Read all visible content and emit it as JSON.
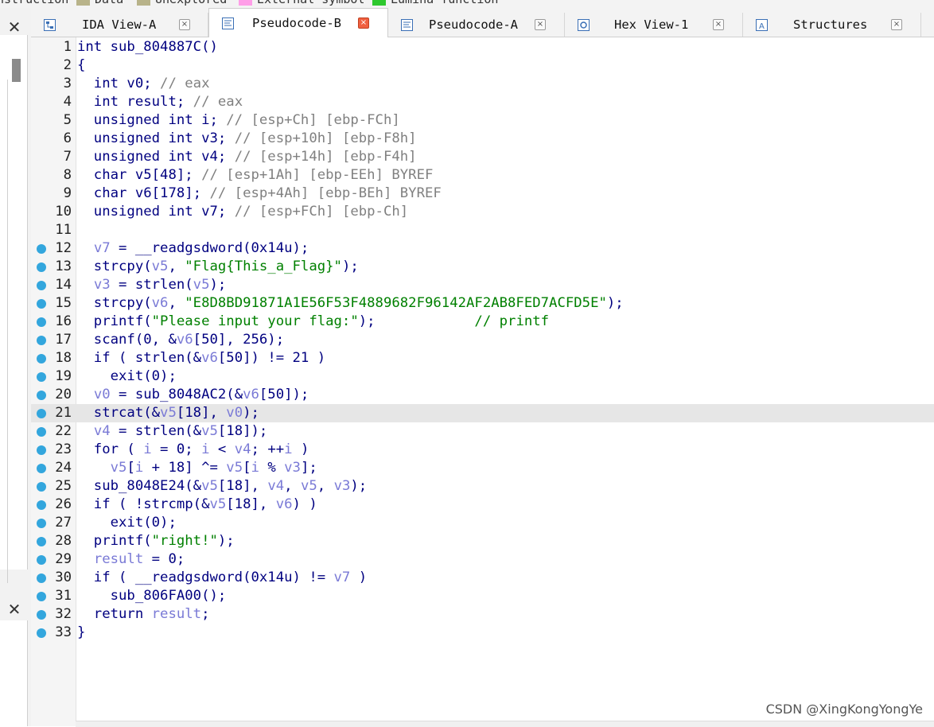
{
  "legend": [
    {
      "label": "nstruction",
      "color": "#ffffff"
    },
    {
      "label": "Data",
      "color": "#b8b38a"
    },
    {
      "label": "Unexplored",
      "color": "#b8b38a"
    },
    {
      "label": "External symbol",
      "color": "#ff9ee8"
    },
    {
      "label": "Lumina function",
      "color": "#2ec82e"
    }
  ],
  "tabs": [
    {
      "label": "IDA View-A",
      "icon": "graph-view-icon",
      "active": false
    },
    {
      "label": "Pseudocode-B",
      "icon": "pseudocode-icon",
      "active": true
    },
    {
      "label": "Pseudocode-A",
      "icon": "pseudocode-icon",
      "active": false
    },
    {
      "label": "Hex View-1",
      "icon": "hex-view-icon",
      "active": false
    },
    {
      "label": "Structures",
      "icon": "structures-icon",
      "active": false
    }
  ],
  "tab_close_glyph": "×",
  "panel_close_glyph": "✕",
  "highlighted_line": "21",
  "lines": [
    {
      "n": "1",
      "dot": false,
      "segs": [
        {
          "t": "int sub_804887C()",
          "c": "k"
        }
      ]
    },
    {
      "n": "2",
      "dot": false,
      "segs": [
        {
          "t": "{",
          "c": "k"
        }
      ]
    },
    {
      "n": "3",
      "dot": false,
      "segs": [
        {
          "t": "  int v0; ",
          "c": "k"
        },
        {
          "t": "// eax",
          "c": "cmt"
        }
      ]
    },
    {
      "n": "4",
      "dot": false,
      "segs": [
        {
          "t": "  int result; ",
          "c": "k"
        },
        {
          "t": "// eax",
          "c": "cmt"
        }
      ]
    },
    {
      "n": "5",
      "dot": false,
      "segs": [
        {
          "t": "  unsigned int i; ",
          "c": "k"
        },
        {
          "t": "// [esp+Ch] [ebp-FCh]",
          "c": "cmt"
        }
      ]
    },
    {
      "n": "6",
      "dot": false,
      "segs": [
        {
          "t": "  unsigned int v3; ",
          "c": "k"
        },
        {
          "t": "// [esp+10h] [ebp-F8h]",
          "c": "cmt"
        }
      ]
    },
    {
      "n": "7",
      "dot": false,
      "segs": [
        {
          "t": "  unsigned int v4; ",
          "c": "k"
        },
        {
          "t": "// [esp+14h] [ebp-F4h]",
          "c": "cmt"
        }
      ]
    },
    {
      "n": "8",
      "dot": false,
      "segs": [
        {
          "t": "  char v5[48]; ",
          "c": "k"
        },
        {
          "t": "// [esp+1Ah] [ebp-EEh] BYREF",
          "c": "cmt"
        }
      ]
    },
    {
      "n": "9",
      "dot": false,
      "segs": [
        {
          "t": "  char v6[178]; ",
          "c": "k"
        },
        {
          "t": "// [esp+4Ah] [ebp-BEh] BYREF",
          "c": "cmt"
        }
      ]
    },
    {
      "n": "10",
      "dot": false,
      "segs": [
        {
          "t": "  unsigned int v7; ",
          "c": "k"
        },
        {
          "t": "// [esp+FCh] [ebp-Ch]",
          "c": "cmt"
        }
      ]
    },
    {
      "n": "11",
      "dot": false,
      "segs": [
        {
          "t": "",
          "c": "k"
        }
      ]
    },
    {
      "n": "12",
      "dot": true,
      "segs": [
        {
          "t": "  ",
          "c": "k"
        },
        {
          "t": "v7",
          "c": "var"
        },
        {
          "t": " = __readgsdword(0x14u);",
          "c": "k"
        }
      ]
    },
    {
      "n": "13",
      "dot": true,
      "segs": [
        {
          "t": "  strcpy(",
          "c": "k"
        },
        {
          "t": "v5",
          "c": "var"
        },
        {
          "t": ", ",
          "c": "k"
        },
        {
          "t": "\"Flag{This_a_Flag}\"",
          "c": "str"
        },
        {
          "t": ");",
          "c": "k"
        }
      ]
    },
    {
      "n": "14",
      "dot": true,
      "segs": [
        {
          "t": "  ",
          "c": "k"
        },
        {
          "t": "v3",
          "c": "var"
        },
        {
          "t": " = strlen(",
          "c": "k"
        },
        {
          "t": "v5",
          "c": "var"
        },
        {
          "t": ");",
          "c": "k"
        }
      ]
    },
    {
      "n": "15",
      "dot": true,
      "segs": [
        {
          "t": "  strcpy(",
          "c": "k"
        },
        {
          "t": "v6",
          "c": "var"
        },
        {
          "t": ", ",
          "c": "k"
        },
        {
          "t": "\"E8D8BD91871A1E56F53F4889682F96142AF2AB8FED7ACFD5E\"",
          "c": "str"
        },
        {
          "t": ");",
          "c": "k"
        }
      ]
    },
    {
      "n": "16",
      "dot": true,
      "segs": [
        {
          "t": "  printf(",
          "c": "k"
        },
        {
          "t": "\"Please input your flag:\"",
          "c": "str"
        },
        {
          "t": ");            ",
          "c": "k"
        },
        {
          "t": "// printf",
          "c": "str"
        }
      ]
    },
    {
      "n": "17",
      "dot": true,
      "segs": [
        {
          "t": "  scanf(0, &",
          "c": "k"
        },
        {
          "t": "v6",
          "c": "var"
        },
        {
          "t": "[50], 256);",
          "c": "k"
        }
      ]
    },
    {
      "n": "18",
      "dot": true,
      "segs": [
        {
          "t": "  if ( strlen(&",
          "c": "k"
        },
        {
          "t": "v6",
          "c": "var"
        },
        {
          "t": "[50]) != 21 )",
          "c": "k"
        }
      ]
    },
    {
      "n": "19",
      "dot": true,
      "segs": [
        {
          "t": "    exit(0);",
          "c": "k"
        }
      ]
    },
    {
      "n": "20",
      "dot": true,
      "segs": [
        {
          "t": "  ",
          "c": "k"
        },
        {
          "t": "v0",
          "c": "var"
        },
        {
          "t": " = sub_8048AC2(&",
          "c": "k"
        },
        {
          "t": "v6",
          "c": "var"
        },
        {
          "t": "[50]);",
          "c": "k"
        }
      ]
    },
    {
      "n": "21",
      "dot": true,
      "segs": [
        {
          "t": "  strcat(&",
          "c": "k"
        },
        {
          "t": "v5",
          "c": "var"
        },
        {
          "t": "[18], ",
          "c": "k"
        },
        {
          "t": "v0",
          "c": "var"
        },
        {
          "t": ");",
          "c": "k"
        }
      ]
    },
    {
      "n": "22",
      "dot": true,
      "segs": [
        {
          "t": "  ",
          "c": "k"
        },
        {
          "t": "v4",
          "c": "var"
        },
        {
          "t": " = strlen(&",
          "c": "k"
        },
        {
          "t": "v5",
          "c": "var"
        },
        {
          "t": "[18]);",
          "c": "k"
        }
      ]
    },
    {
      "n": "23",
      "dot": true,
      "segs": [
        {
          "t": "  for ( ",
          "c": "k"
        },
        {
          "t": "i",
          "c": "var"
        },
        {
          "t": " = 0; ",
          "c": "k"
        },
        {
          "t": "i",
          "c": "var"
        },
        {
          "t": " < ",
          "c": "k"
        },
        {
          "t": "v4",
          "c": "var"
        },
        {
          "t": "; ++",
          "c": "k"
        },
        {
          "t": "i",
          "c": "var"
        },
        {
          "t": " )",
          "c": "k"
        }
      ]
    },
    {
      "n": "24",
      "dot": true,
      "segs": [
        {
          "t": "    ",
          "c": "k"
        },
        {
          "t": "v5",
          "c": "var"
        },
        {
          "t": "[",
          "c": "k"
        },
        {
          "t": "i",
          "c": "var"
        },
        {
          "t": " + 18] ^= ",
          "c": "k"
        },
        {
          "t": "v5",
          "c": "var"
        },
        {
          "t": "[",
          "c": "k"
        },
        {
          "t": "i",
          "c": "var"
        },
        {
          "t": " % ",
          "c": "k"
        },
        {
          "t": "v3",
          "c": "var"
        },
        {
          "t": "];",
          "c": "k"
        }
      ]
    },
    {
      "n": "25",
      "dot": true,
      "segs": [
        {
          "t": "  sub_8048E24(&",
          "c": "k"
        },
        {
          "t": "v5",
          "c": "var"
        },
        {
          "t": "[18], ",
          "c": "k"
        },
        {
          "t": "v4",
          "c": "var"
        },
        {
          "t": ", ",
          "c": "k"
        },
        {
          "t": "v5",
          "c": "var"
        },
        {
          "t": ", ",
          "c": "k"
        },
        {
          "t": "v3",
          "c": "var"
        },
        {
          "t": ");",
          "c": "k"
        }
      ]
    },
    {
      "n": "26",
      "dot": true,
      "segs": [
        {
          "t": "  if ( !strcmp(&",
          "c": "k"
        },
        {
          "t": "v5",
          "c": "var"
        },
        {
          "t": "[18], ",
          "c": "k"
        },
        {
          "t": "v6",
          "c": "var"
        },
        {
          "t": ") )",
          "c": "k"
        }
      ]
    },
    {
      "n": "27",
      "dot": true,
      "segs": [
        {
          "t": "    exit(0);",
          "c": "k"
        }
      ]
    },
    {
      "n": "28",
      "dot": true,
      "segs": [
        {
          "t": "  printf(",
          "c": "k"
        },
        {
          "t": "\"right!\"",
          "c": "str"
        },
        {
          "t": ");",
          "c": "k"
        }
      ]
    },
    {
      "n": "29",
      "dot": true,
      "segs": [
        {
          "t": "  ",
          "c": "k"
        },
        {
          "t": "result",
          "c": "var"
        },
        {
          "t": " = 0;",
          "c": "k"
        }
      ]
    },
    {
      "n": "30",
      "dot": true,
      "segs": [
        {
          "t": "  if ( __readgsdword(0x14u) != ",
          "c": "k"
        },
        {
          "t": "v7",
          "c": "var"
        },
        {
          "t": " )",
          "c": "k"
        }
      ]
    },
    {
      "n": "31",
      "dot": true,
      "segs": [
        {
          "t": "    sub_806FA00();",
          "c": "k"
        }
      ]
    },
    {
      "n": "32",
      "dot": true,
      "segs": [
        {
          "t": "  return ",
          "c": "k"
        },
        {
          "t": "result",
          "c": "var"
        },
        {
          "t": ";",
          "c": "k"
        }
      ]
    },
    {
      "n": "33",
      "dot": true,
      "segs": [
        {
          "t": "}",
          "c": "k"
        }
      ]
    }
  ],
  "watermark": "CSDN @XingKongYongYe"
}
